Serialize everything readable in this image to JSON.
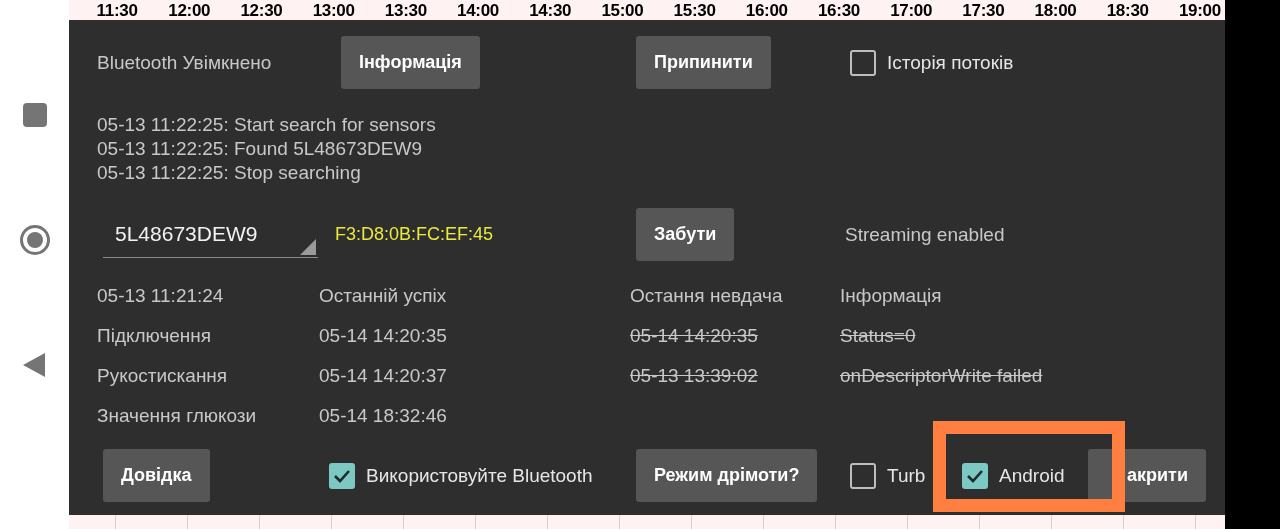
{
  "timeline": {
    "labels": [
      "11:30",
      "12:00",
      "12:30",
      "13:00",
      "13:30",
      "14:00",
      "14:30",
      "15:00",
      "15:30",
      "16:00",
      "16:30",
      "17:00",
      "17:30",
      "18:00",
      "18:30",
      "19:00"
    ]
  },
  "status": {
    "label": "Bluetooth Увімкнено"
  },
  "top_buttons": [
    "Інформація",
    "Припинити"
  ],
  "stream_history": {
    "label": "Історія потоків",
    "checked": false
  },
  "log": [
    "05-13 11:22:25: Start search for sensors",
    "05-13 11:22:25: Found 5L48673DEW9",
    "05-13 11:22:25: Stop searching"
  ],
  "sensor": {
    "value": "5L48673DEW9",
    "address": "F3:D8:0B:FC:EF:45"
  },
  "forget_button": "Забути",
  "streaming_status": "Streaming enabled",
  "table": {
    "columns": [
      "05-13 11:21:24",
      "Останній успіх",
      "Остання невдача",
      "Інформація"
    ],
    "rows": [
      {
        "cells": [
          {
            "text": "Підключення",
            "struck": false
          },
          {
            "text": "05-14 14:20:35",
            "struck": false
          },
          {
            "text": "05-14 14:20:35",
            "struck": true
          },
          {
            "text": "Status=0",
            "struck": true
          }
        ]
      },
      {
        "cells": [
          {
            "text": "Рукостискання",
            "struck": false
          },
          {
            "text": "05-14 14:20:37",
            "struck": false
          },
          {
            "text": "05-13 13:39:02",
            "struck": true
          },
          {
            "text": "onDescriptorWrite failed",
            "struck": true
          }
        ]
      },
      {
        "cells": [
          {
            "text": "Значення глюкози",
            "struck": false
          },
          {
            "text": "05-14 18:32:46",
            "struck": false
          }
        ]
      }
    ]
  },
  "bottom": [
    {
      "kind": "button",
      "label": "Довідка"
    },
    {
      "kind": "checkbox",
      "label": "Використовуйте Bluetooth",
      "checked": true
    },
    {
      "kind": "button",
      "label": "Режим дрімоти?"
    },
    {
      "kind": "checkbox",
      "label": "Turb",
      "checked": false
    },
    {
      "kind": "checkbox",
      "label": "Android",
      "checked": true
    },
    {
      "kind": "button",
      "label": "акрити"
    }
  ],
  "annotation": {
    "kind": "highlight-box"
  }
}
